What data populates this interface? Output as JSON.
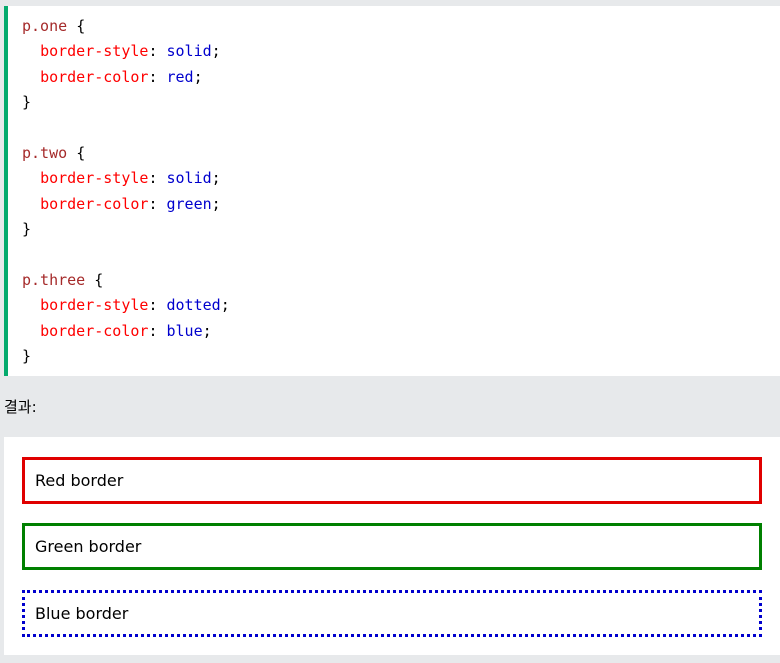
{
  "code": {
    "blocks": [
      {
        "selector": "p.one",
        "open": "{",
        "close": "}",
        "declarations": [
          {
            "property": "border-style",
            "value": "solid"
          },
          {
            "property": "border-color",
            "value": "red"
          }
        ]
      },
      {
        "selector": "p.two",
        "open": "{",
        "close": "}",
        "declarations": [
          {
            "property": "border-style",
            "value": "solid"
          },
          {
            "property": "border-color",
            "value": "green"
          }
        ]
      },
      {
        "selector": "p.three",
        "open": "{",
        "close": "}",
        "declarations": [
          {
            "property": "border-style",
            "value": "dotted"
          },
          {
            "property": "border-color",
            "value": "blue"
          }
        ]
      }
    ]
  },
  "result": {
    "label": "결과:",
    "items": [
      {
        "text": "Red border",
        "border_style": "solid",
        "border_color": "#e00000"
      },
      {
        "text": "Green border",
        "border_style": "solid",
        "border_color": "#008000"
      },
      {
        "text": "Blue border",
        "border_style": "dotted",
        "border_color": "#0000cd"
      }
    ]
  },
  "colors": {
    "accent_bar": "#04aa6d",
    "selector": "#a52a2a",
    "property": "#ff0000",
    "value": "#0000cd",
    "page_background": "#e7e9eb"
  }
}
